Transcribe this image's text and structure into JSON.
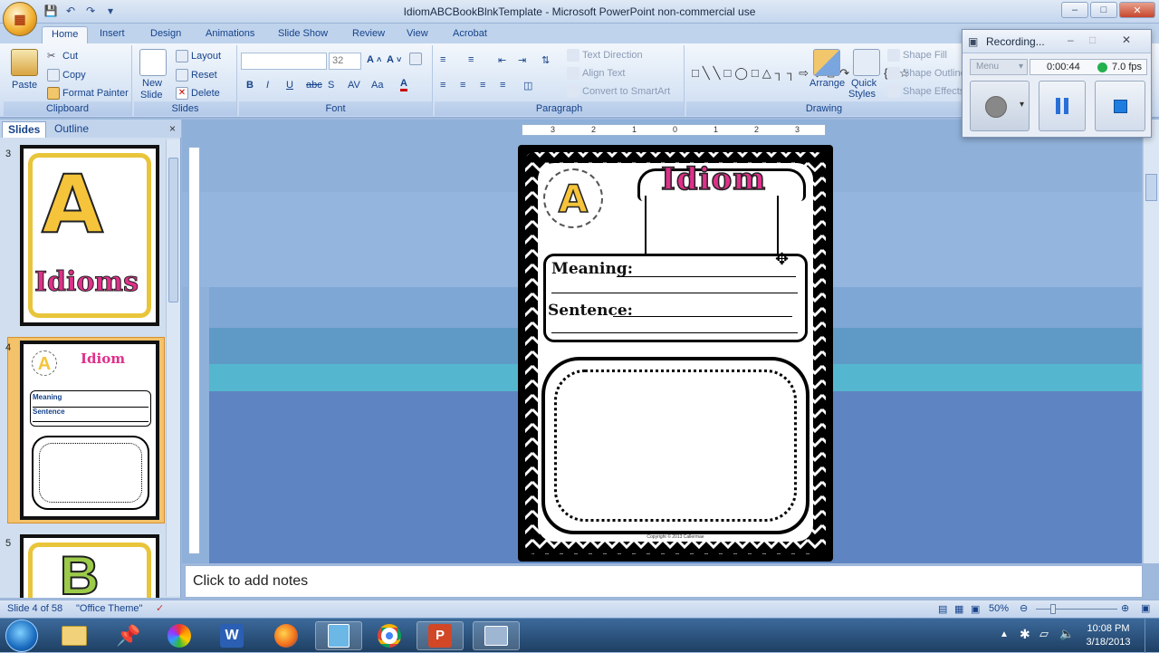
{
  "window": {
    "title": "IdiomABCBookBlnkTemplate - Microsoft PowerPoint non-commercial use"
  },
  "tabs": [
    "Home",
    "Insert",
    "Design",
    "Animations",
    "Slide Show",
    "Review",
    "View",
    "Acrobat"
  ],
  "ribbon": {
    "clipboard": {
      "paste": "Paste",
      "cut": "Cut",
      "copy": "Copy",
      "format_painter": "Format Painter",
      "label": "Clipboard"
    },
    "slides": {
      "new_slide_1": "New",
      "new_slide_2": "Slide",
      "layout": "Layout",
      "reset": "Reset",
      "delete": "Delete",
      "label": "Slides"
    },
    "font": {
      "font_name": "",
      "font_size": "32",
      "label": "Font"
    },
    "paragraph": {
      "text_direction": "Text Direction",
      "align_text": "Align Text",
      "convert_smartart": "Convert to SmartArt",
      "label": "Paragraph"
    },
    "drawing": {
      "arrange": "Arrange",
      "quick_styles_1": "Quick",
      "quick_styles_2": "Styles",
      "shape_fill": "Shape Fill",
      "shape_outline": "Shape Outline",
      "shape_effects": "Shape Effects",
      "label": "Drawing"
    }
  },
  "left_pane": {
    "tab_slides": "Slides",
    "tab_outline": "Outline",
    "close": "×",
    "thumbs": [
      {
        "num": "3",
        "letter": "A",
        "word": "Idioms"
      },
      {
        "num": "4",
        "letter": "A",
        "word": "Idiom",
        "meaning": "Meaning",
        "sentence": "Sentence"
      },
      {
        "num": "5",
        "letter": "B"
      }
    ]
  },
  "slide": {
    "letter": "A",
    "title": "Idiom",
    "meaning_label": "Meaning:",
    "sentence_label": "Sentence:",
    "copyright": "Copyright © 2013 Callermae"
  },
  "ruler": {
    "ticks": [
      "3",
      "2",
      "1",
      "0",
      "1",
      "2",
      "3"
    ]
  },
  "notes": {
    "placeholder": "Click to add notes"
  },
  "status": {
    "slide_info": "Slide 4 of 58",
    "theme": "\"Office Theme\"",
    "zoom": "50%"
  },
  "recorder": {
    "title": "Recording...",
    "menu": "Menu",
    "time": "0:00:44",
    "fps": "7.0 fps"
  },
  "taskbar": {
    "time": "10:08 PM",
    "date": "3/18/2013"
  },
  "colors": {
    "accent_pink": "#e0308a",
    "accent_yellow": "#f5c43a",
    "ribbon_blue": "#15428b"
  }
}
